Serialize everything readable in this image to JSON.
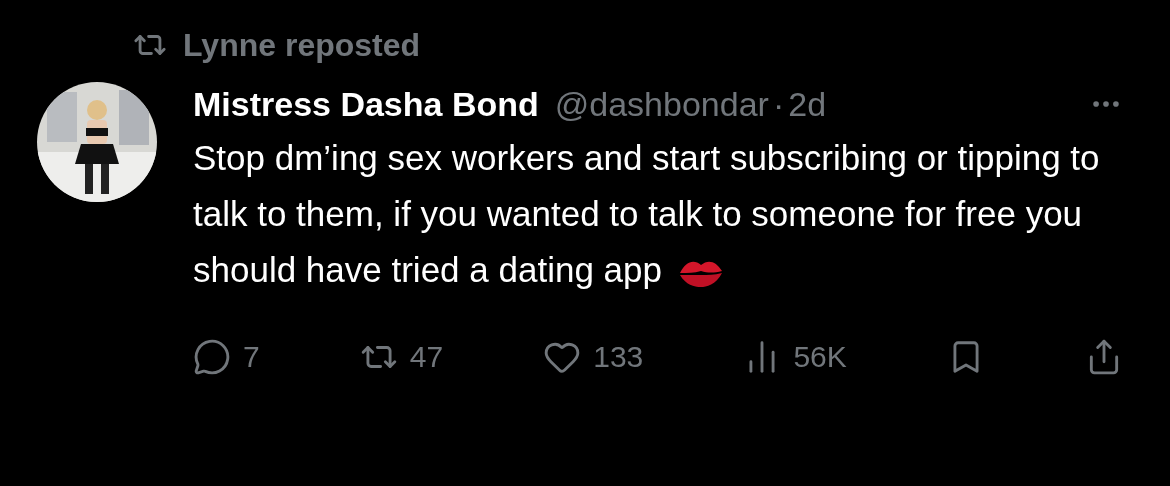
{
  "repost": {
    "label": "Lynne reposted"
  },
  "tweet": {
    "name": "Mistress Dasha Bond",
    "handle": "@dashbondar",
    "separator": "·",
    "time": "2d",
    "body": "Stop dm’ing sex workers and start subscribing or tipping to talk to them, if you wanted to talk to someone for free you should have tried a dating app"
  },
  "actions": [
    {
      "kind": "reply",
      "count": "7"
    },
    {
      "kind": "repost",
      "count": "47"
    },
    {
      "kind": "like",
      "count": "133"
    },
    {
      "kind": "views",
      "count": "56K"
    },
    {
      "kind": "bookmark"
    },
    {
      "kind": "share"
    }
  ]
}
